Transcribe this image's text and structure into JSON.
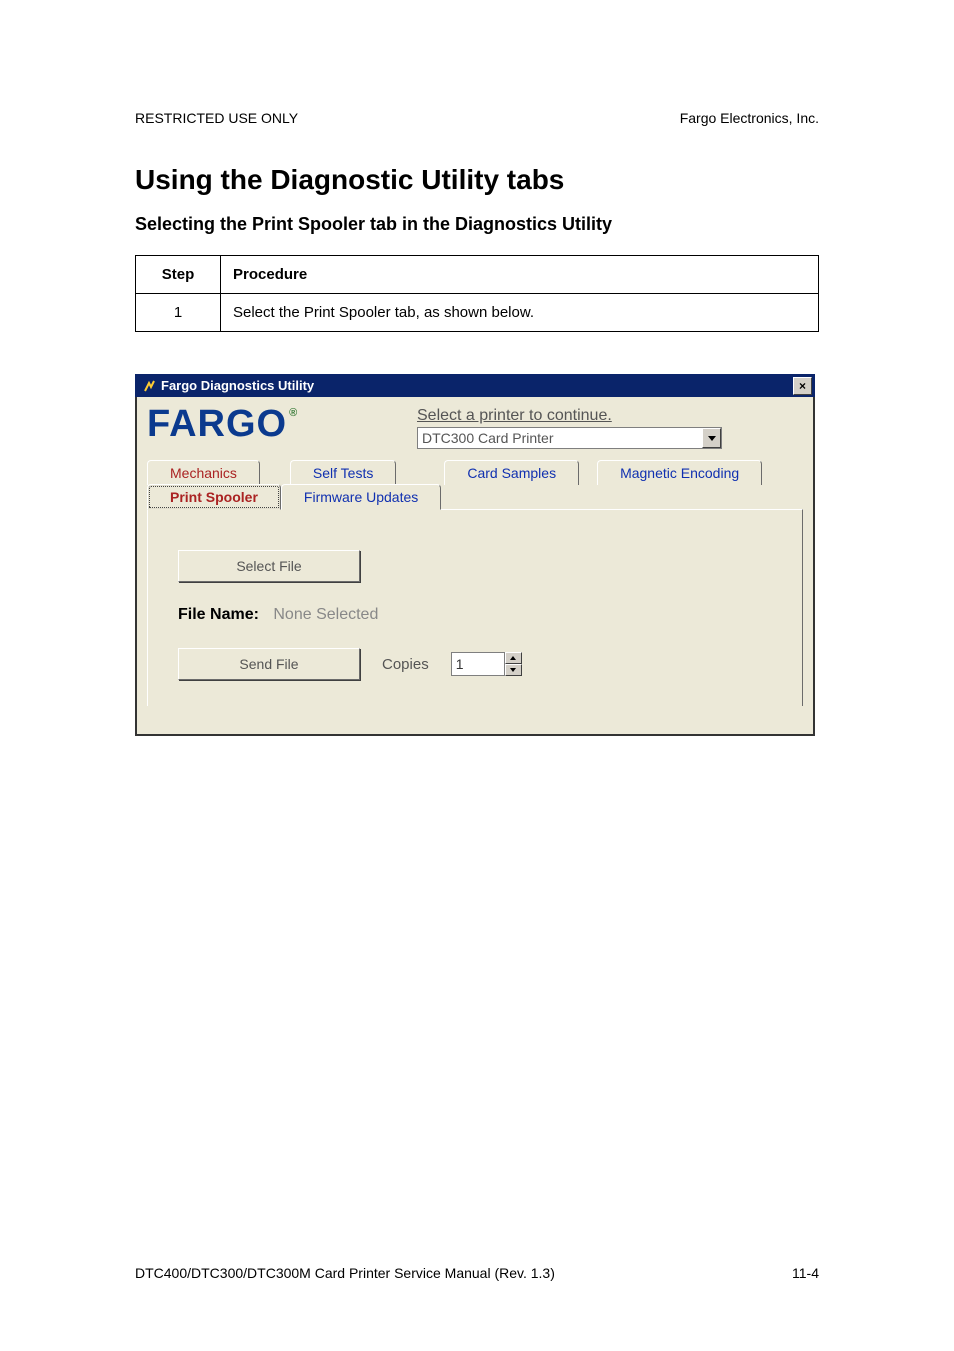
{
  "header": {
    "left": "RESTRICTED USE ONLY",
    "right": "Fargo Electronics, Inc."
  },
  "titles": {
    "section": "Using the Diagnostic Utility tabs",
    "subsection": "Selecting the Print Spooler tab in the Diagnostics Utility"
  },
  "table": {
    "head_step": "Step",
    "head_proc": "Procedure",
    "rows": [
      {
        "step": "1",
        "proc": "Select the Print Spooler tab, as shown below."
      }
    ]
  },
  "window": {
    "title": "Fargo Diagnostics Utility",
    "close_label": "×",
    "logo": "FARGO",
    "logo_mark": "®",
    "select_printer_label": "Select a printer to continue.",
    "printer_selected": "DTC300 Card Printer",
    "tabs_back": {
      "mechanics": "Mechanics",
      "self_tests": "Self Tests",
      "card_samples": "Card Samples",
      "magnetic_encoding": "Magnetic Encoding"
    },
    "tabs_front": {
      "print_spooler": "Print Spooler",
      "firmware_updates": "Firmware Updates"
    },
    "buttons": {
      "select_file": "Select File",
      "send_file": "Send File"
    },
    "file_name_label": "File Name:",
    "file_name_value": "None Selected",
    "copies_label": "Copies",
    "copies_value": "1"
  },
  "footer": {
    "left": "DTC400/DTC300/DTC300M Card Printer Service Manual (Rev. 1.3)",
    "right": "11-4"
  }
}
